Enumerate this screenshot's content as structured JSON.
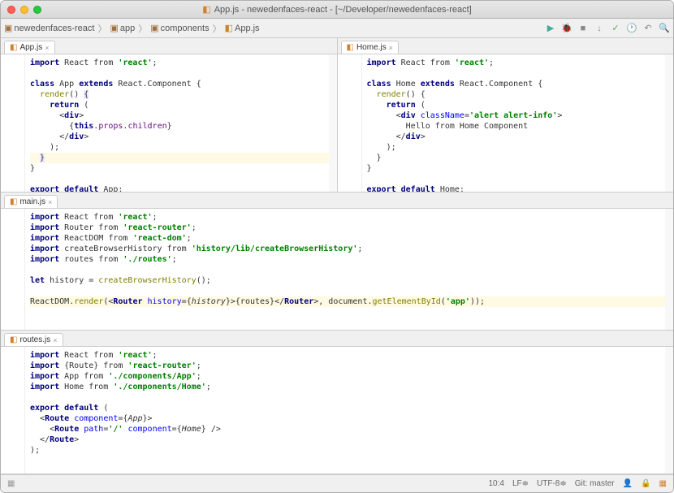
{
  "title": "App.js - newedenfaces-react - [~/Developer/newedenfaces-react]",
  "breadcrumb": [
    "newedenfaces-react",
    "app",
    "components",
    "App.js"
  ],
  "panes": {
    "app": {
      "tab": "App.js"
    },
    "home": {
      "tab": "Home.js"
    },
    "main": {
      "tab": "main.js"
    },
    "routes": {
      "tab": "routes.js"
    }
  },
  "status": {
    "pos": "10:4",
    "lf": "LF",
    "enc": "UTF-8",
    "git": "Git: master"
  }
}
